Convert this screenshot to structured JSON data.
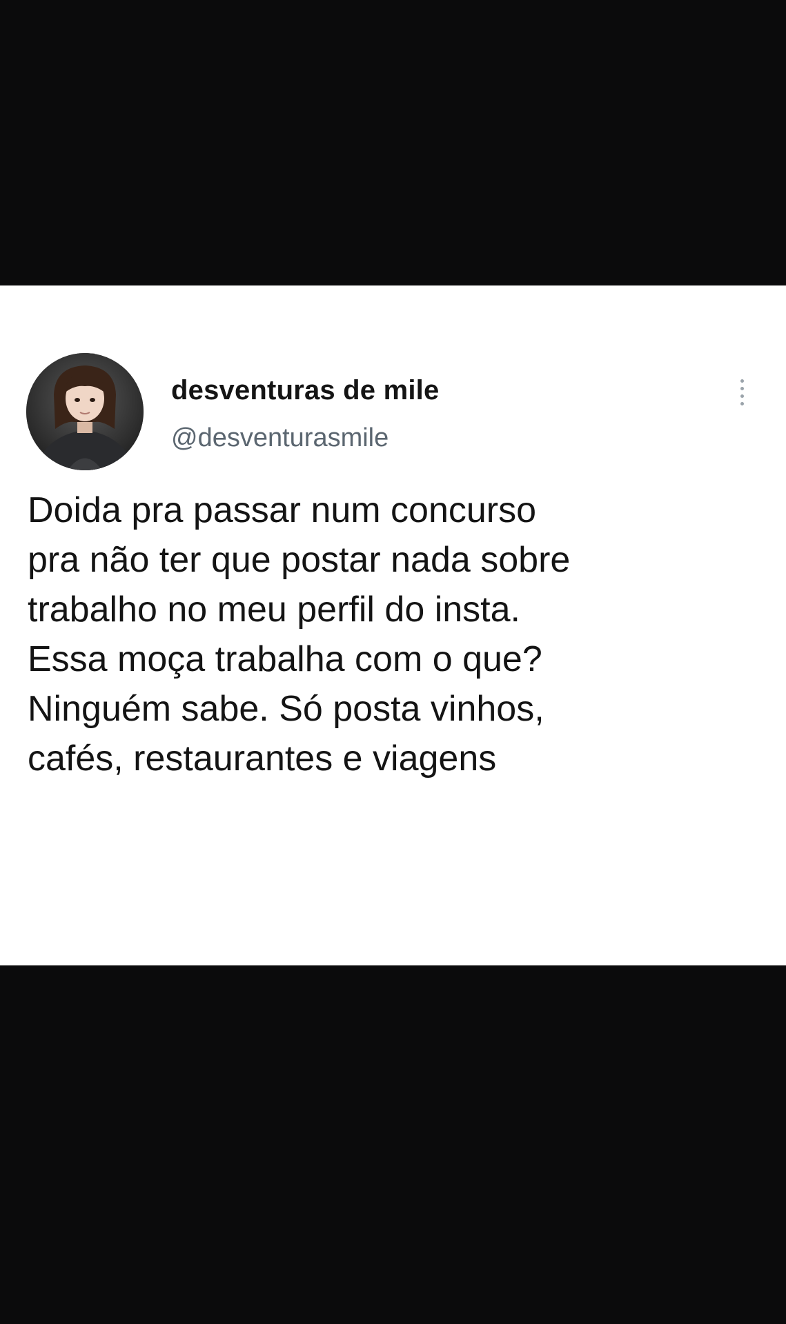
{
  "tweet": {
    "display_name": "desventuras de mile",
    "handle": "@desventurasmile",
    "lines": [
      "Doida pra passar num concurso",
      "pra não ter que postar nada sobre",
      "trabalho no meu perfil do insta.",
      "Essa moça trabalha com o que?",
      "Ninguém sabe. Só posta vinhos,",
      "cafés, restaurantes e viagens"
    ],
    "more_icon": "vertical-ellipsis-icon",
    "avatar_icon": "profile-photo"
  },
  "colors": {
    "background_band": "#0b0b0c",
    "card": "#ffffff",
    "text": "#141414",
    "handle": "#5b6670"
  }
}
